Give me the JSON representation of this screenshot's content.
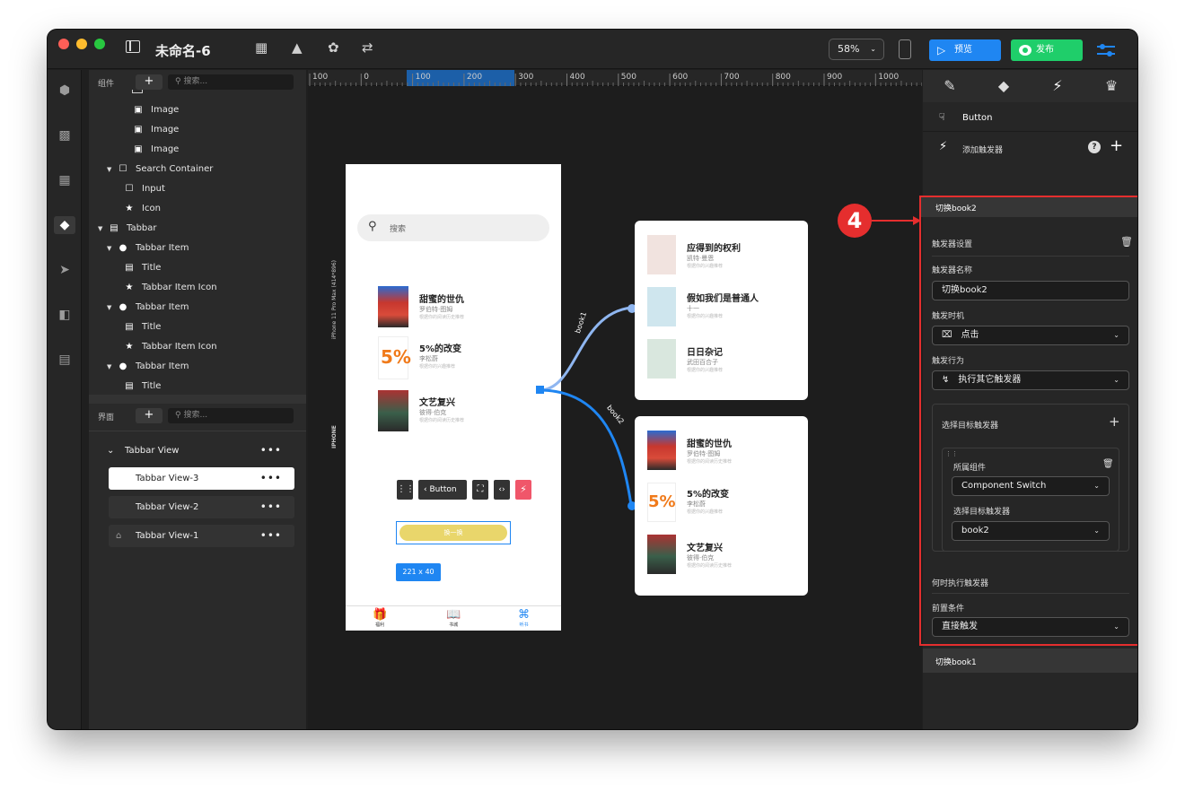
{
  "window": {
    "doc_title": "未命名-6",
    "zoom": "58%",
    "preview_label": "预览",
    "publish_label": "发布"
  },
  "colors": {
    "accent": "#1f86f2",
    "publish": "#1fce6a",
    "highlight": "#e52e2e"
  },
  "layers": {
    "components_label": "组件",
    "search_placeholder": "搜索...",
    "rows": [
      {
        "label": "Image",
        "icon": "image-icon"
      },
      {
        "label": "Image",
        "icon": "image-icon"
      },
      {
        "label": "Image",
        "icon": "image-icon"
      },
      {
        "label": "Search Container",
        "icon": "square-icon"
      },
      {
        "label": "Input",
        "icon": "square-icon"
      },
      {
        "label": "Icon",
        "icon": "star-icon"
      },
      {
        "label": "Tabbar",
        "icon": "tabbar-icon"
      },
      {
        "label": "Tabbar Item",
        "icon": "item-icon"
      },
      {
        "label": "Title",
        "icon": "text-icon"
      },
      {
        "label": "Tabbar Item Icon",
        "icon": "star-icon"
      },
      {
        "label": "Tabbar Item",
        "icon": "item-icon"
      },
      {
        "label": "Title",
        "icon": "text-icon"
      },
      {
        "label": "Tabbar Item Icon",
        "icon": "star-icon"
      },
      {
        "label": "Tabbar Item",
        "icon": "item-icon"
      },
      {
        "label": "Title",
        "icon": "text-icon"
      }
    ],
    "screens_label": "界面",
    "screens_search_placeholder": "搜索...",
    "views": [
      "Tabbar View",
      "Tabbar View-3",
      "Tabbar View-2",
      "Tabbar View-1"
    ]
  },
  "ruler": [
    "100",
    "0",
    "100",
    "200",
    "300",
    "400",
    "500",
    "600",
    "700",
    "800",
    "900",
    "1000"
  ],
  "canvas": {
    "device_label": "iPhone 11 Pro Max (414*896)",
    "device_short": "IPHONE",
    "phone_search": "搜索",
    "books_left": [
      {
        "title": "甜蜜的世仇",
        "author": "罗伯特·图姆",
        "desc": "根据你的阅读历史推荐"
      },
      {
        "title": "5%的改变",
        "author": "李松蔚",
        "desc": "根据你的兴趣推荐"
      },
      {
        "title": "文艺复兴",
        "author": "彼得·伯克",
        "desc": "根据你的阅读历史推荐"
      }
    ],
    "toolbar_button": "Button",
    "yellow_button": "换一换",
    "size_badge": "221 x 40",
    "tabbar": [
      "福利",
      "书城",
      "听书"
    ],
    "book1_label": "book1",
    "book2_label": "book2",
    "card1_books": [
      {
        "title": "应得到的权利",
        "author": "凯特·曼恩",
        "desc": "根据你的兴趣推荐"
      },
      {
        "title": "假如我们是普通人",
        "author": "十一",
        "desc": "根据你的兴趣推荐"
      },
      {
        "title": "日日杂记",
        "author": "武田百合子",
        "desc": "根据你的兴趣推荐"
      }
    ],
    "card2_books": [
      {
        "title": "甜蜜的世仇",
        "author": "罗伯特·图姆",
        "desc": "根据你的阅读历史推荐"
      },
      {
        "title": "5%的改变",
        "author": "李松蔚",
        "desc": "根据你的兴趣推荐"
      },
      {
        "title": "文艺复兴",
        "author": "彼得·伯克",
        "desc": "根据你的阅读历史推荐"
      }
    ]
  },
  "inspector": {
    "selected": "Button",
    "add_trigger": "添加触发器",
    "annotation_number": "4",
    "trigger_name_header": "切换book2",
    "trigger_settings": "触发器设置",
    "trigger_name_label": "触发器名称",
    "trigger_name_value": "切换book2",
    "trigger_timing_label": "触发时机",
    "trigger_timing_value": "点击",
    "trigger_action_label": "触发行为",
    "trigger_action_value": "执行其它触发器",
    "target_section": "选择目标触发器",
    "owner_label": "所属组件",
    "owner_value": "Component Switch",
    "target_label": "选择目标触发器",
    "target_value": "book2",
    "when_label": "何时执行触发器",
    "precondition_label": "前置条件",
    "precondition_value": "直接触发",
    "next_trigger": "切换book1"
  }
}
